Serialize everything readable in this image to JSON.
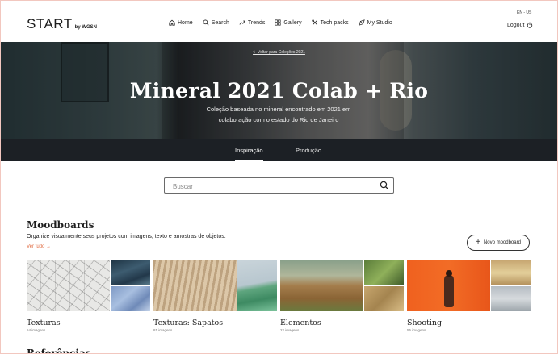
{
  "brand": {
    "name": "START",
    "sub": "by WGSN"
  },
  "nav": [
    {
      "label": "Home",
      "icon": "home-icon"
    },
    {
      "label": "Search",
      "icon": "search-icon"
    },
    {
      "label": "Trends",
      "icon": "trend-icon"
    },
    {
      "label": "Gallery",
      "icon": "gallery-icon"
    },
    {
      "label": "Tech packs",
      "icon": "techpack-icon"
    },
    {
      "label": "My Studio",
      "icon": "studio-icon"
    }
  ],
  "locale": "EN - US",
  "logout_label": "Logout",
  "hero": {
    "back_link": "<- Voltar para Coleções 2021",
    "title": "Mineral 2021 Colab + Rio",
    "subtitle": "Coleção baseada no mineral encontrado em 2021 em colaboração com o estado do Rio de Janeiro"
  },
  "tabs": [
    {
      "label": "Inspiração",
      "active": true
    },
    {
      "label": "Produção",
      "active": false
    }
  ],
  "search": {
    "placeholder": "Buscar"
  },
  "moodboards": {
    "title": "Moodboards",
    "description": "Organize visualmente seus projetos com imagens, texto e amostras de objetos.",
    "see_all": "Ver tudo →",
    "new_button": "Novo moodboard",
    "cards": [
      {
        "title": "Texturas",
        "count": "54 imagens"
      },
      {
        "title": "Texturas: Sapatos",
        "count": "81 imagens"
      },
      {
        "title": "Elementos",
        "count": "22 imagens"
      },
      {
        "title": "Shooting",
        "count": "55 imagens"
      }
    ]
  },
  "references": {
    "title": "Referências"
  },
  "colors": {
    "accent": "#e06a3f",
    "tabbar": "#1c2025",
    "frame": "#f2c7bf"
  }
}
